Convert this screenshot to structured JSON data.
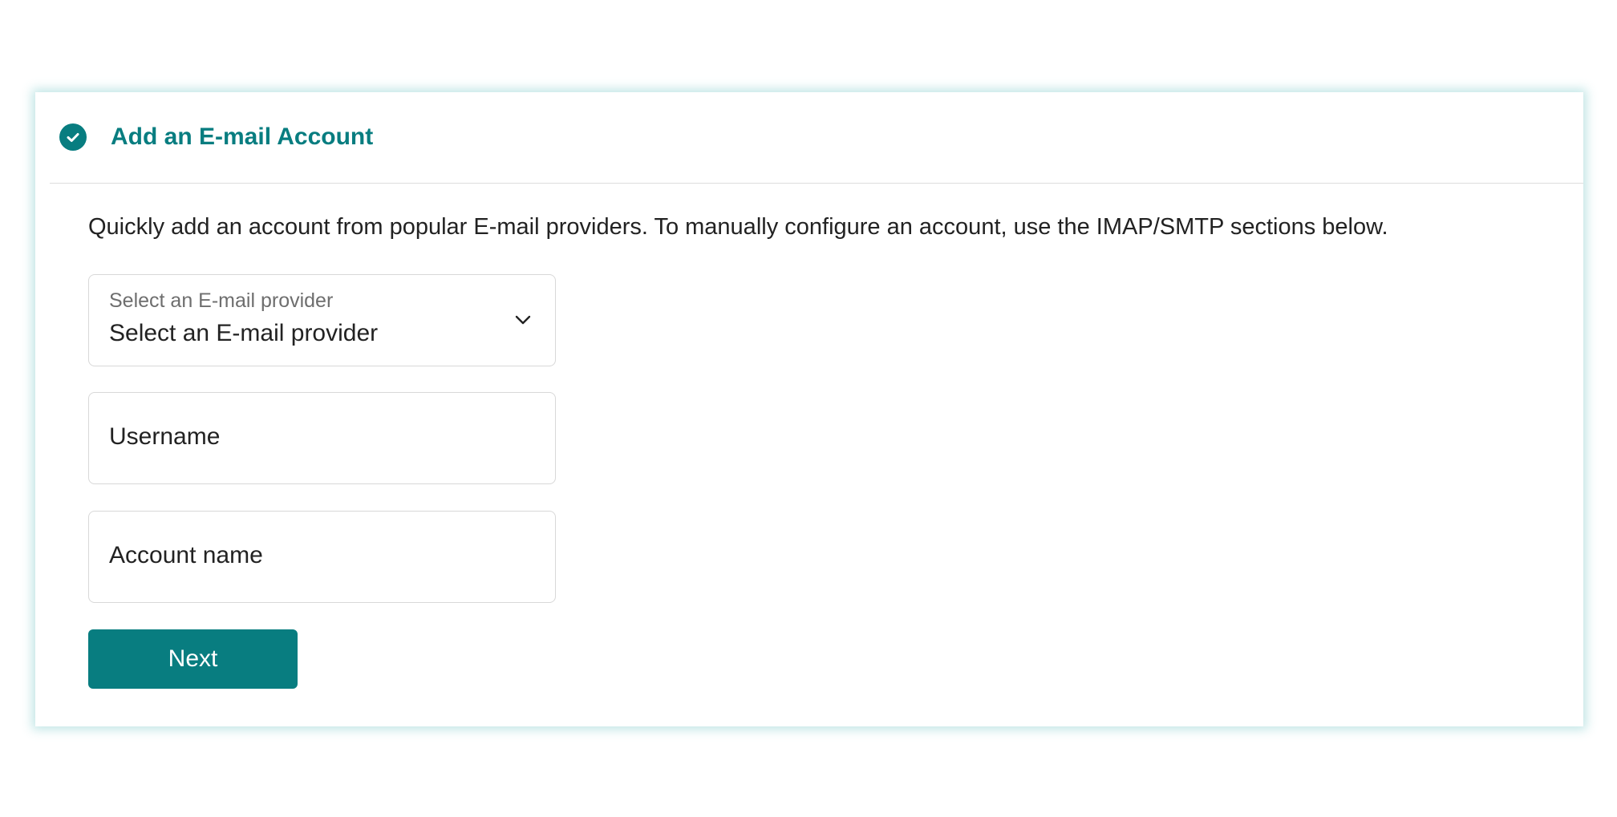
{
  "form": {
    "title": "Add an E-mail Account",
    "title_icon": "check-circle-icon",
    "description": "Quickly add an account from popular E-mail providers. To manually configure an account, use the IMAP/SMTP sections below.",
    "provider_select": {
      "label": "Select an E-mail provider",
      "value": "Select an E-mail provider",
      "icon": "chevron-down-icon"
    },
    "username_field": {
      "placeholder": "Username"
    },
    "account_name_field": {
      "placeholder": "Account name"
    },
    "next_button": {
      "label": "Next"
    }
  },
  "colors": {
    "accent": "#087d80",
    "panel_glow": "#78c8c8",
    "text": "#222222",
    "muted_text": "#6e6e6e",
    "border": "#d8d8d8"
  }
}
